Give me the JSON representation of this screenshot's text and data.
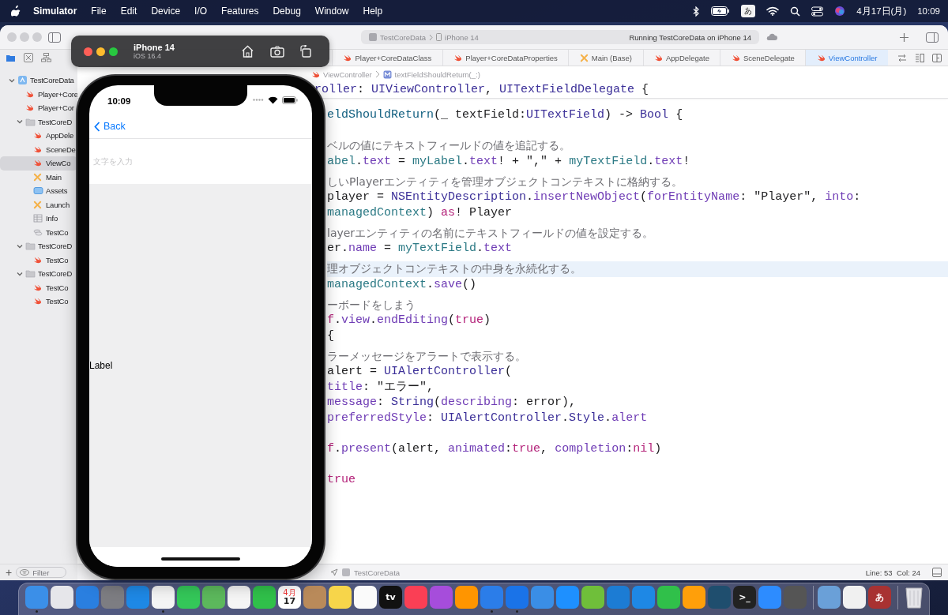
{
  "menubar": {
    "menus": [
      {
        "label": "Simulator",
        "kind": "app"
      },
      {
        "label": "File",
        "kind": "menu"
      },
      {
        "label": "Edit",
        "kind": "menu"
      },
      {
        "label": "Device",
        "kind": "menu"
      },
      {
        "label": "I/O",
        "kind": "menu"
      },
      {
        "label": "Features",
        "kind": "menu"
      },
      {
        "label": "Debug",
        "kind": "menu"
      },
      {
        "label": "Window",
        "kind": "menu"
      },
      {
        "label": "Help",
        "kind": "menu"
      }
    ],
    "input_source": "あ",
    "date": "4月17日(月)",
    "time": "10:09"
  },
  "xcode": {
    "scheme": {
      "project": "TestCoreData",
      "device": "iPhone 14",
      "status": "Running TestCoreData on iPhone 14"
    },
    "navigator": {
      "add_button": "+",
      "filter_placeholder": "Filter",
      "tree": [
        {
          "label": "TestCoreData",
          "kind": "project",
          "selected": false,
          "expanded": true,
          "children": [
            {
              "label": "Player+Core",
              "kind": "swift",
              "selected": false
            },
            {
              "label": "Player+Cor",
              "kind": "swift",
              "selected": false
            },
            {
              "label": "TestCoreD",
              "kind": "folder",
              "selected": false,
              "expanded": true,
              "children": [
                {
                  "label": "AppDele",
                  "kind": "swift",
                  "selected": false
                },
                {
                  "label": "SceneDe",
                  "kind": "swift",
                  "selected": false
                },
                {
                  "label": "ViewCo",
                  "kind": "swift",
                  "selected": true
                },
                {
                  "label": "Main",
                  "kind": "storyboard",
                  "selected": false
                },
                {
                  "label": "Assets",
                  "kind": "assets",
                  "selected": false
                },
                {
                  "label": "Launch",
                  "kind": "storyboard",
                  "selected": false
                },
                {
                  "label": "Info",
                  "kind": "plist",
                  "selected": false
                },
                {
                  "label": "TestCo",
                  "kind": "datamodel",
                  "selected": false
                }
              ]
            },
            {
              "label": "TestCoreD",
              "kind": "folder",
              "selected": false,
              "expanded": true,
              "children": [
                {
                  "label": "TestCo",
                  "kind": "swift",
                  "selected": false
                }
              ]
            },
            {
              "label": "TestCoreD",
              "kind": "folder",
              "selected": false,
              "expanded": true,
              "children": [
                {
                  "label": "TestCo",
                  "kind": "swift",
                  "selected": false
                },
                {
                  "label": "TestCo",
                  "kind": "swift",
                  "selected": false
                }
              ]
            }
          ]
        }
      ]
    },
    "tabs": [
      {
        "label": "Player+CoreDataClass",
        "kind": "swift",
        "selected": false
      },
      {
        "label": "Player+CoreDataProperties",
        "kind": "swift",
        "selected": false
      },
      {
        "label": "Main (Base)",
        "kind": "storyboard",
        "selected": false
      },
      {
        "label": "AppDelegate",
        "kind": "swift",
        "selected": false
      },
      {
        "label": "SceneDelegate",
        "kind": "swift",
        "selected": false
      },
      {
        "label": "ViewController",
        "kind": "swift",
        "selected": true
      }
    ],
    "breadcrumb": [
      {
        "label": "ViewController",
        "kind": "swift"
      },
      {
        "label": "textFieldShouldReturn(_:)",
        "kind": "method"
      }
    ],
    "editor": {
      "sticky_line": [
        {
          "text": "roller",
          "kind": "type"
        },
        {
          "text": ": ",
          "kind": "plain"
        },
        {
          "text": "UIViewController",
          "kind": "type"
        },
        {
          "text": ", ",
          "kind": "plain"
        },
        {
          "text": "UITextFieldDelegate",
          "kind": "type"
        },
        {
          "text": " {",
          "kind": "plain"
        }
      ],
      "lines": [
        {
          "kind": "code",
          "current": false,
          "tokens": [
            {
              "text": "eldShouldReturn",
              "kind": "decl"
            },
            {
              "text": "(_ textField:",
              "kind": "plain"
            },
            {
              "text": "UITextField",
              "kind": "type"
            },
            {
              "text": ") -> ",
              "kind": "plain"
            },
            {
              "text": "Bool",
              "kind": "type"
            },
            {
              "text": " {",
              "kind": "plain"
            }
          ]
        },
        {
          "kind": "blank"
        },
        {
          "kind": "comment",
          "current": false,
          "text": "ベルの値にテキストフィールドの値を追記する。"
        },
        {
          "kind": "code",
          "current": false,
          "tokens": [
            {
              "text": "abel",
              "kind": "var"
            },
            {
              "text": ".",
              "kind": "plain"
            },
            {
              "text": "text",
              "kind": "member"
            },
            {
              "text": " = ",
              "kind": "plain"
            },
            {
              "text": "myLabel",
              "kind": "var"
            },
            {
              "text": ".",
              "kind": "plain"
            },
            {
              "text": "text",
              "kind": "member"
            },
            {
              "text": "! + \",\" + ",
              "kind": "plain"
            },
            {
              "text": "myTextField",
              "kind": "var"
            },
            {
              "text": ".",
              "kind": "plain"
            },
            {
              "text": "text",
              "kind": "member"
            },
            {
              "text": "!",
              "kind": "plain"
            }
          ]
        },
        {
          "kind": "comment",
          "current": false,
          "text": "しいPlayerエンティティを管理オブジェクトコンテキストに格納する。"
        },
        {
          "kind": "code",
          "current": false,
          "tokens": [
            {
              "text": "player = ",
              "kind": "plain"
            },
            {
              "text": "NSEntityDescription",
              "kind": "type"
            },
            {
              "text": ".",
              "kind": "plain"
            },
            {
              "text": "insertNewObject",
              "kind": "member"
            },
            {
              "text": "(",
              "kind": "plain"
            },
            {
              "text": "forEntityName",
              "kind": "member"
            },
            {
              "text": ": \"Player\", ",
              "kind": "plain"
            },
            {
              "text": "into",
              "kind": "member"
            },
            {
              "text": ":",
              "kind": "plain"
            }
          ]
        },
        {
          "kind": "code",
          "current": false,
          "tokens": [
            {
              "text": "managedContext",
              "kind": "var"
            },
            {
              "text": ") ",
              "kind": "plain"
            },
            {
              "text": "as",
              "kind": "keyword"
            },
            {
              "text": "! Player",
              "kind": "plain"
            }
          ]
        },
        {
          "kind": "comment",
          "current": false,
          "text": "layerエンティティの名前にテキストフィールドの値を設定する。"
        },
        {
          "kind": "code",
          "current": false,
          "tokens": [
            {
              "text": "er",
              "kind": "plain"
            },
            {
              "text": ".",
              "kind": "plain"
            },
            {
              "text": "name",
              "kind": "member"
            },
            {
              "text": " = ",
              "kind": "plain"
            },
            {
              "text": "myTextField",
              "kind": "var"
            },
            {
              "text": ".",
              "kind": "plain"
            },
            {
              "text": "text",
              "kind": "member"
            }
          ]
        },
        {
          "kind": "comment",
          "current": true,
          "text": "理オブジェクトコンテキストの中身を永続化する。"
        },
        {
          "kind": "code",
          "current": false,
          "tokens": [
            {
              "text": "managedContext",
              "kind": "var"
            },
            {
              "text": ".",
              "kind": "plain"
            },
            {
              "text": "save",
              "kind": "member"
            },
            {
              "text": "()",
              "kind": "plain"
            }
          ]
        },
        {
          "kind": "comment",
          "current": false,
          "text": "ーボードをしまう"
        },
        {
          "kind": "code",
          "current": false,
          "tokens": [
            {
              "text": "f",
              "kind": "keyword"
            },
            {
              "text": ".",
              "kind": "plain"
            },
            {
              "text": "view",
              "kind": "member"
            },
            {
              "text": ".",
              "kind": "plain"
            },
            {
              "text": "endEditing",
              "kind": "member"
            },
            {
              "text": "(",
              "kind": "plain"
            },
            {
              "text": "true",
              "kind": "keyword"
            },
            {
              "text": ")",
              "kind": "plain"
            }
          ]
        },
        {
          "kind": "code",
          "current": false,
          "tokens": [
            {
              "text": "{",
              "kind": "plain"
            }
          ]
        },
        {
          "kind": "comment",
          "current": false,
          "text": "ラーメッセージをアラートで表示する。"
        },
        {
          "kind": "code",
          "current": false,
          "tokens": [
            {
              "text": "alert = ",
              "kind": "plain"
            },
            {
              "text": "UIAlertController",
              "kind": "type"
            },
            {
              "text": "(",
              "kind": "plain"
            }
          ]
        },
        {
          "kind": "code",
          "current": false,
          "tokens": [
            {
              "text": "title",
              "kind": "member"
            },
            {
              "text": ": \"エラー\",",
              "kind": "plain"
            }
          ]
        },
        {
          "kind": "code",
          "current": false,
          "tokens": [
            {
              "text": "message",
              "kind": "member"
            },
            {
              "text": ": ",
              "kind": "plain"
            },
            {
              "text": "String",
              "kind": "type"
            },
            {
              "text": "(",
              "kind": "plain"
            },
            {
              "text": "describing",
              "kind": "member"
            },
            {
              "text": ": error),",
              "kind": "plain"
            }
          ]
        },
        {
          "kind": "code",
          "current": false,
          "tokens": [
            {
              "text": "preferredStyle",
              "kind": "member"
            },
            {
              "text": ": ",
              "kind": "plain"
            },
            {
              "text": "UIAlertController",
              "kind": "type"
            },
            {
              "text": ".",
              "kind": "plain"
            },
            {
              "text": "Style",
              "kind": "type"
            },
            {
              "text": ".",
              "kind": "plain"
            },
            {
              "text": "alert",
              "kind": "member"
            }
          ]
        },
        {
          "kind": "blank"
        },
        {
          "kind": "code",
          "current": false,
          "tokens": [
            {
              "text": "f",
              "kind": "keyword"
            },
            {
              "text": ".",
              "kind": "plain"
            },
            {
              "text": "present",
              "kind": "member"
            },
            {
              "text": "(alert, ",
              "kind": "plain"
            },
            {
              "text": "animated",
              "kind": "member"
            },
            {
              "text": ":",
              "kind": "plain"
            },
            {
              "text": "true",
              "kind": "keyword"
            },
            {
              "text": ", ",
              "kind": "plain"
            },
            {
              "text": "completion",
              "kind": "member"
            },
            {
              "text": ":",
              "kind": "plain"
            },
            {
              "text": "nil",
              "kind": "keyword"
            },
            {
              "text": ")",
              "kind": "plain"
            }
          ]
        },
        {
          "kind": "blank"
        },
        {
          "kind": "code",
          "current": false,
          "tokens": [
            {
              "text": "true",
              "kind": "keyword"
            }
          ]
        }
      ]
    },
    "status_bar": {
      "target": "TestCoreData",
      "position": "Line: 53  Col: 24"
    }
  },
  "simulator": {
    "device": "iPhone 14",
    "os": "iOS 16.4",
    "screen": {
      "time": "10:09",
      "back": "Back",
      "field_placeholder": "文字を入力",
      "label": "Label"
    }
  },
  "dock": {
    "apps": [
      {
        "color": "#3b8fe8",
        "running": true
      },
      {
        "color": "#e6e6ea",
        "running": false
      },
      {
        "color": "#2a7fe0",
        "running": false
      },
      {
        "color": "#7d7d82",
        "running": false
      },
      {
        "color": "#1e88e5",
        "running": false
      },
      {
        "color": "#f4f4f4",
        "running": true
      },
      {
        "color": "#34c759",
        "running": false
      },
      {
        "color": "#5cb85c",
        "running": false
      },
      {
        "color": "#f5f5f5",
        "running": false
      },
      {
        "color": "#30c04a",
        "running": false
      },
      {
        "color": "#ffffff",
        "running": false,
        "month": "4月",
        "glyph": "17"
      },
      {
        "color": "#b98a5a",
        "running": false
      },
      {
        "color": "#f7d54a",
        "running": false
      },
      {
        "color": "#fafafa",
        "running": false
      },
      {
        "color": "#111111",
        "running": false,
        "glyph": "tv"
      },
      {
        "color": "#fa3f55",
        "running": false
      },
      {
        "color": "#a64ddb",
        "running": false
      },
      {
        "color": "#ff9500",
        "running": false
      },
      {
        "color": "#2b7de9",
        "running": true
      },
      {
        "color": "#1a73e8",
        "running": true
      },
      {
        "color": "#3a8ee6",
        "running": false
      },
      {
        "color": "#1e90ff",
        "running": false
      },
      {
        "color": "#6fbf3a",
        "running": false
      },
      {
        "color": "#1c7cd4",
        "running": false
      },
      {
        "color": "#1e88e5",
        "running": false
      },
      {
        "color": "#30c04a",
        "running": false
      },
      {
        "color": "#ff9f0a",
        "running": false
      },
      {
        "color": "#1f4e6e",
        "running": false
      },
      {
        "color": "#222222",
        "running": false,
        "glyph": ">_"
      },
      {
        "color": "#2d8cff",
        "running": false
      },
      {
        "color": "#555555",
        "running": false
      }
    ],
    "documents": [
      {
        "color": "#6aa0d8",
        "running": false
      },
      {
        "color": "#f0f0f0",
        "running": false
      },
      {
        "color": "#a83232",
        "running": false,
        "glyph": "あ"
      }
    ]
  }
}
